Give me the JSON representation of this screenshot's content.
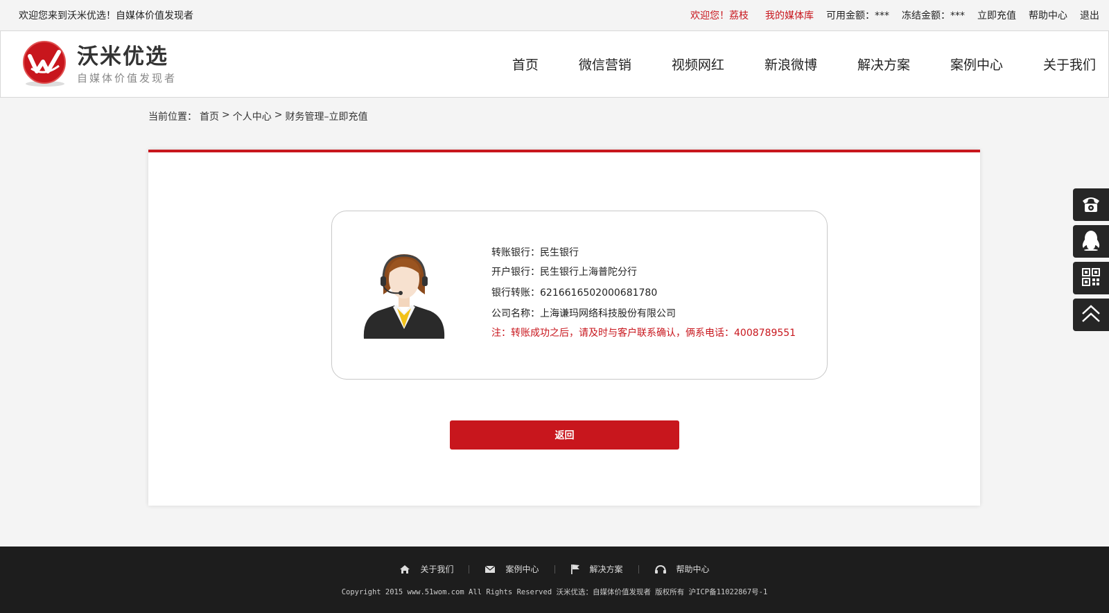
{
  "topbar": {
    "welcome": "欢迎您来到沃米优选！自媒体价值发现者",
    "user_greeting": "欢迎您！荔枝",
    "media_library": "我的媒体库",
    "available_amount": "可用金额：***",
    "frozen_amount": "冻结金额：***",
    "recharge": "立即充值",
    "help": "帮助中心",
    "logout": "退出"
  },
  "logo": {
    "title": "沃米优选",
    "subtitle": "自媒体价值发现者"
  },
  "nav": [
    "首页",
    "微信营销",
    "视频网红",
    "新浪微博",
    "解决方案",
    "案例中心",
    "关于我们"
  ],
  "breadcrumb": {
    "prefix": "当前位置：",
    "home": "首页",
    "sep1": ">",
    "personal": "个人中心",
    "sep2": ">",
    "current": "财务管理–立即充值"
  },
  "bank_info": {
    "transfer_bank": "转账银行：民生银行",
    "open_bank": "开户银行：民生银行上海普陀分行",
    "account": "银行转账：6216616502000681780",
    "company": "公司名称：上海谦玛网络科技股份有限公司",
    "note": "注：转账成功之后，请及时与客户联系确认，俩系电话：4008789551"
  },
  "back_button": "返回",
  "side_tools": [
    "phone-icon",
    "qq-icon",
    "qrcode-icon",
    "back-to-top-icon"
  ],
  "footer": {
    "links": [
      "关于我们",
      "案例中心",
      "解决方案",
      "帮助中心"
    ],
    "copyright": "Copyright 2015 www.51wom.com All Rights Reserved 沃米优选：自媒体价值发现者 版权所有 沪ICP备11022867号-1"
  },
  "colors": {
    "brand_red": "#c8161d",
    "footer_bg": "#1d1d1d",
    "side_bg": "#262626"
  }
}
